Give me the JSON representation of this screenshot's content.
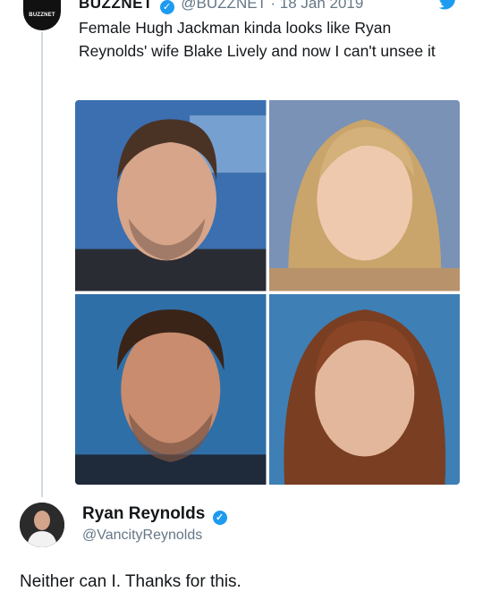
{
  "tweet": {
    "avatar_text": "BUZZNET",
    "name": "BUZZNET",
    "handle": "@BUZZNET",
    "date": "· 18 Jan 2019",
    "text": "Female Hugh Jackman kinda looks like Ryan Reynolds' wife Blake Lively and now I can't unsee it"
  },
  "reply": {
    "name": "Ryan Reynolds",
    "handle": "@VancityReynolds",
    "text": "Neither can I. Thanks for this."
  },
  "icons": [
    "verified-badge-icon",
    "twitter-bird-icon"
  ],
  "colors": {
    "accent": "#1d9bf0",
    "muted": "#657786"
  }
}
